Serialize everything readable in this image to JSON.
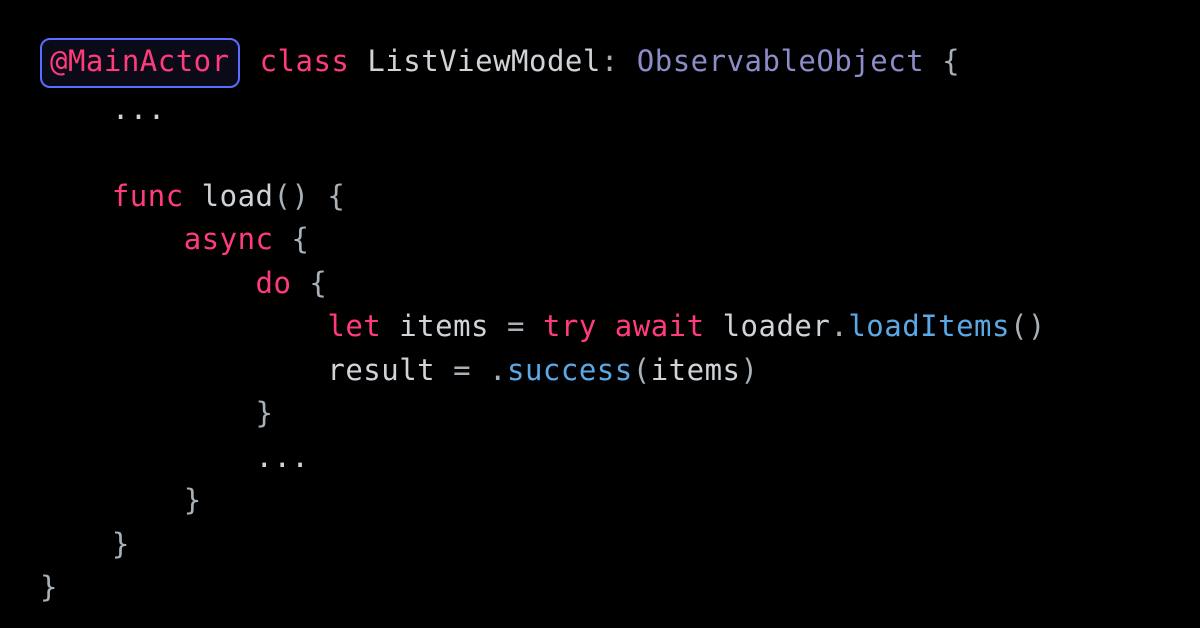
{
  "code": {
    "attr": "@MainActor",
    "kw_class": "class",
    "class_name": "ListViewModel",
    "colon1": ":",
    "protocol": "ObservableObject",
    "brace_open": "{",
    "ellipsis1": "...",
    "kw_func": "func",
    "func_name": "load",
    "parens": "()",
    "brace_open2": "{",
    "kw_async": "async",
    "brace_open3": "{",
    "kw_do": "do",
    "brace_open4": "{",
    "kw_let": "let",
    "var_items": "items",
    "eq": "=",
    "kw_try": "try",
    "kw_await": "await",
    "obj_loader": "loader",
    "dot1": ".",
    "call_loadItems": "loadItems",
    "parens2": "()",
    "var_result": "result",
    "eq2": "=",
    "dot2": ".",
    "enum_success": "success",
    "paren_open": "(",
    "arg_items": "items",
    "paren_close": ")",
    "brace_close4": "}",
    "ellipsis2": "...",
    "brace_close3": "}",
    "brace_close2": "}",
    "brace_close1": "}"
  }
}
